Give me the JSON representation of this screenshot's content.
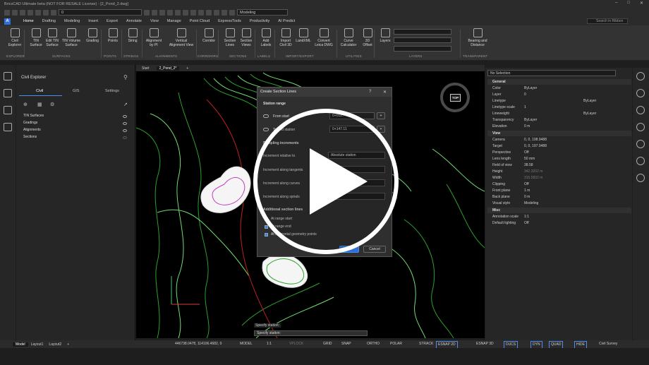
{
  "window": {
    "title": "BricsCAD Ultimate beta (NOT FOR RESALE License) - [2_Pond_2.dwg]"
  },
  "qat": {
    "layer_value": "0",
    "workspace": "Modeling"
  },
  "menu": {
    "logo": "A",
    "tabs": [
      "Home",
      "Drafting",
      "Modeling",
      "Insert",
      "Export",
      "Annotate",
      "View",
      "Manage",
      "Point Cloud",
      "ExpressTools",
      "Productivity",
      "AI Predict"
    ],
    "search_placeholder": "Search in Ribbon"
  },
  "ribbon": {
    "buttons": [
      {
        "label": "Civil\nExplorer"
      },
      {
        "label": "TIN\nSurface"
      },
      {
        "label": "Edit TIN\nSurface"
      },
      {
        "label": "TIN Volume\nSurface"
      },
      {
        "label": "Grading"
      },
      {
        "label": "Points"
      },
      {
        "label": "String"
      },
      {
        "label": "Alignment\nby PI"
      },
      {
        "label": "Vertical\nAlignment View"
      },
      {
        "label": "Corridor"
      },
      {
        "label": "Section\nLines"
      },
      {
        "label": "Section\nViews"
      },
      {
        "label": "Add\nLabels"
      },
      {
        "label": "Import\nCivil 3D"
      },
      {
        "label": "LandXML"
      },
      {
        "label": "Convert\nLeica DWG"
      },
      {
        "label": "Curve\nCalculator"
      },
      {
        "label": "3D\nOffset"
      },
      {
        "label": "Layers"
      },
      {
        "label": "Bearing and\nDistance"
      }
    ],
    "groups": [
      "EXPLORER",
      "SURFACES",
      "POINTS",
      "STRINGS",
      "ALIGNMENTS",
      "CORRIDORS",
      "SECTIONS",
      "LABELS",
      "IMPORT/EXPORT",
      "UTILITIES",
      "LAYERS",
      "TRANSPARENT"
    ]
  },
  "explorer": {
    "title": "Civil Explorer",
    "tabs": [
      "Civil",
      "GIS",
      "Settings"
    ],
    "tree": [
      "TIN Surfaces",
      "Gradings",
      "Alignments",
      "Sections"
    ]
  },
  "doctabs": {
    "start": "Start",
    "current": "2_Pond_2*"
  },
  "viewcube": {
    "label": "TOP"
  },
  "dialog": {
    "title": "Create Section Lines",
    "station_range": "Station range",
    "from_start": "From start",
    "from_value": "0+012.??",
    "to_end": "To end station",
    "to_value": "0+147.11",
    "sampling": "Sampling increments",
    "inc_relative": "Increment relative to",
    "inc_relative_value": "Absolute station",
    "inc_tangents": "Increment along tangents",
    "inc_curves": "Increment along curves",
    "inc_spirals": "Increment along spirals",
    "additional": "Additional section lines",
    "at_start": "At range start",
    "at_end": "At range end",
    "at_points": "At horizontal geometry points",
    "ok": "OK",
    "cancel": "Cancel"
  },
  "properties": {
    "selection": "No Selection",
    "sections": [
      {
        "name": "General",
        "rows": [
          [
            "Color",
            "ByLayer"
          ],
          [
            "Layer",
            "0"
          ],
          [
            "Linetype",
            "ByLayer"
          ],
          [
            "Linetype scale",
            "1"
          ],
          [
            "Lineweight",
            "ByLayer"
          ],
          [
            "Transparency",
            "ByLayer"
          ],
          [
            "Elevation",
            "0 m"
          ]
        ]
      },
      {
        "name": "View",
        "rows": [
          [
            "Camera",
            "0, 0, 198.9488"
          ],
          [
            "Target",
            "0, 0, 197.9488"
          ],
          [
            "Perspective",
            "Off"
          ],
          [
            "Lens length",
            "50 mm"
          ],
          [
            "Field of view",
            "38.58"
          ],
          [
            "Height",
            "342.3202 m"
          ],
          [
            "Width",
            "315.5832 m"
          ],
          [
            "Clipping",
            "Off"
          ],
          [
            "Front plane",
            "1 m"
          ],
          [
            "Back plane",
            "0 m"
          ],
          [
            "Visual style",
            "Modeling"
          ]
        ]
      },
      {
        "name": "Misc",
        "rows": [
          [
            "Annotation scale",
            "1:1"
          ],
          [
            "Default lighting",
            "Off"
          ]
        ]
      }
    ]
  },
  "command": {
    "history": "Specify station:",
    "prompt": "Specify station:"
  },
  "status": {
    "layout_tabs": [
      "Model",
      "Layout1",
      "Layout2"
    ],
    "coords": "446738.0478, 114106.4682, 0",
    "items": [
      "MODEL",
      "1:1",
      "VPLOCK",
      "GRID",
      "SNAP",
      "ORTHO",
      "POLAR",
      "STRACK",
      "ESNAP 2D",
      "ESNAP 3D",
      "DUCS",
      "DYN",
      "QUAD",
      "HIDE",
      "Civil Survey"
    ]
  }
}
